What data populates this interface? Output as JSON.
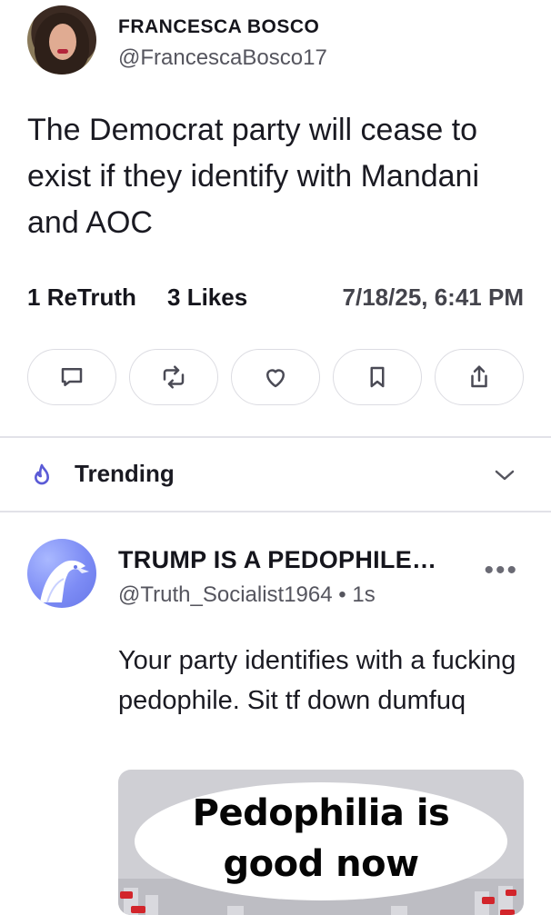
{
  "post": {
    "author_name": "FRANCESCA BOSCO",
    "author_handle": "@FrancescaBosco17",
    "text": "The Democrat party will cease to exist if they identify with Mandani and AOC",
    "retruth_count": "1",
    "retruth_label": "ReTruth",
    "likes_count": "3",
    "likes_label": "Likes",
    "timestamp": "7/18/25, 6:41 PM",
    "actions": [
      {
        "name": "reply",
        "icon": "comment-icon"
      },
      {
        "name": "retruth",
        "icon": "retruth-icon"
      },
      {
        "name": "like",
        "icon": "heart-icon"
      },
      {
        "name": "bookmark",
        "icon": "bookmark-icon"
      },
      {
        "name": "share",
        "icon": "share-icon"
      }
    ]
  },
  "trending": {
    "label": "Trending",
    "icon": "flame-icon",
    "accent": "#5b5bd6"
  },
  "feed_item": {
    "author_name": "TRUMP IS A PEDOPHILE…",
    "author_handle": "@Truth_Socialist1964",
    "separator": "•",
    "age": "1s",
    "more_label": "•••",
    "text": "Your party identifies with a fucking pedophile. Sit tf down dumfuq",
    "media_text_line1": "Pedophilia is",
    "media_text_line2": "good now"
  }
}
